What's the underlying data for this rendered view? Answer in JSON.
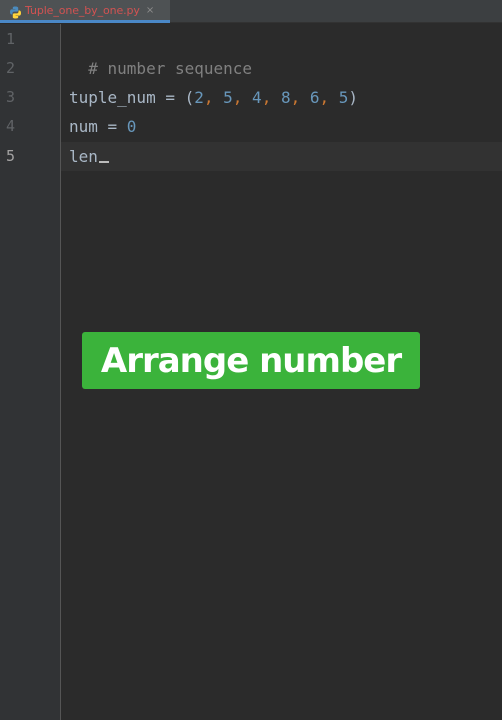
{
  "tab": {
    "filename": "Tuple_one_by_one.py",
    "close_label": "×",
    "icon": "python-file-icon"
  },
  "gutter": {
    "line_numbers": [
      "1",
      "2",
      "3",
      "4",
      "5"
    ],
    "active_line": "5"
  },
  "code": {
    "line1": {
      "comment": "# number sequence"
    },
    "line3": {
      "prefix": "tuple_num = (",
      "numbers": [
        "2",
        "5",
        "4",
        "8",
        "6",
        "5"
      ],
      "separator": ", ",
      "suffix": ")"
    },
    "line4": {
      "prefix": "num = ",
      "value": "0"
    },
    "line5": {
      "text": "len"
    }
  },
  "banner": {
    "text": "Arrange number"
  },
  "colors": {
    "editor_bg": "#2b2b2b",
    "gutter_bg": "#313335",
    "comment": "#808080",
    "number": "#6897bb",
    "comma": "#cc7832",
    "identifier": "#a9b7c6",
    "tab_text": "#d25252",
    "banner_bg": "#3bb33b"
  }
}
